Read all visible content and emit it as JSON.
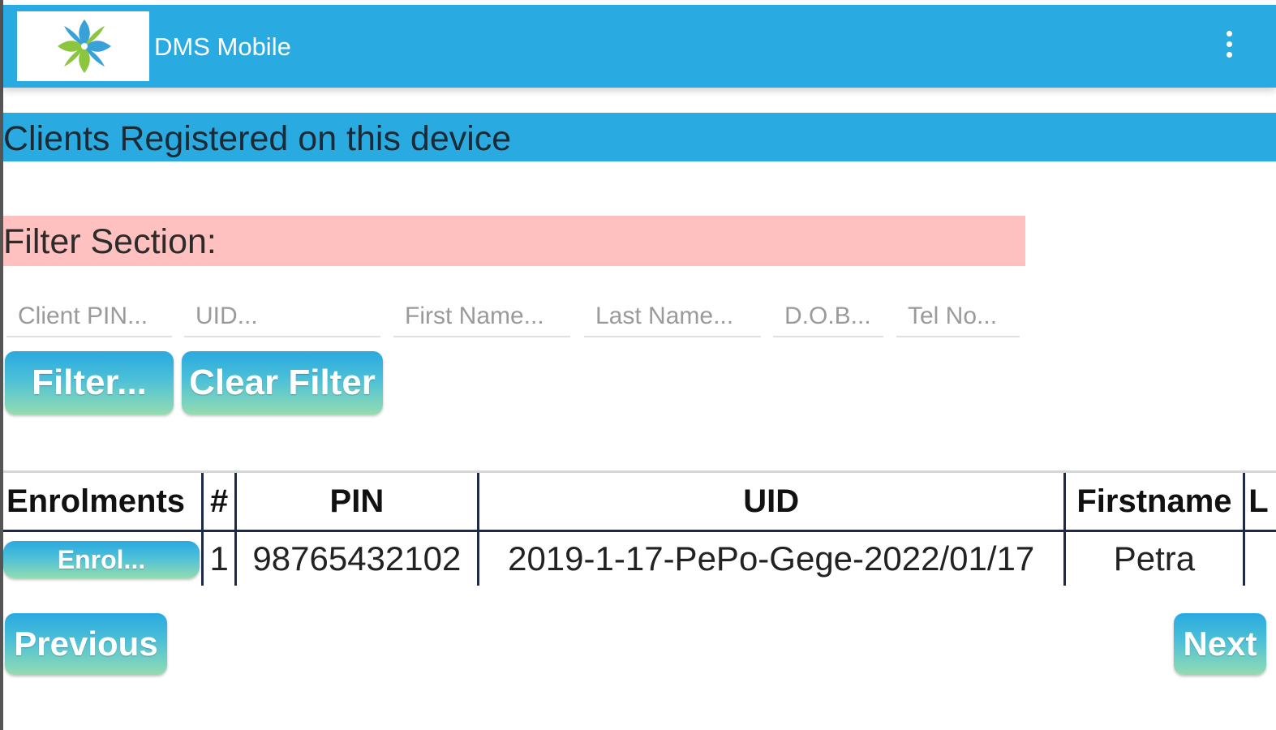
{
  "app": {
    "title": "DMS Mobile",
    "logo_icon": "dms-logo-icon",
    "menu_icon": "overflow-menu-icon",
    "brand_color": "#29abe2"
  },
  "page": {
    "heading": "Clients Registered on this device"
  },
  "filter": {
    "heading": "Filter Section:",
    "heading_color": "#ffc0c0",
    "fields": {
      "client_pin": {
        "placeholder": "Client PIN...",
        "value": ""
      },
      "uid": {
        "placeholder": "UID...",
        "value": ""
      },
      "first_name": {
        "placeholder": "First Name...",
        "value": ""
      },
      "last_name": {
        "placeholder": "Last Name...",
        "value": ""
      },
      "dob": {
        "placeholder": "D.O.B...",
        "value": ""
      },
      "tel_no": {
        "placeholder": "Tel No...",
        "value": ""
      }
    },
    "filter_label": "Filter...",
    "clear_label": "Clear Filter"
  },
  "table": {
    "headers": {
      "enrolments": "Enrolments",
      "num": "#",
      "pin": "PIN",
      "uid": "UID",
      "firstname": "Firstname",
      "next_col": "L"
    },
    "rows": [
      {
        "enrol_label": "Enrol...",
        "num": "1",
        "pin": "98765432102",
        "uid": "2019-1-17-PePo-Gege-2022/01/17",
        "firstname": "Petra",
        "next_col": ""
      }
    ]
  },
  "pagination": {
    "previous_label": "Previous",
    "next_label": "Next"
  }
}
